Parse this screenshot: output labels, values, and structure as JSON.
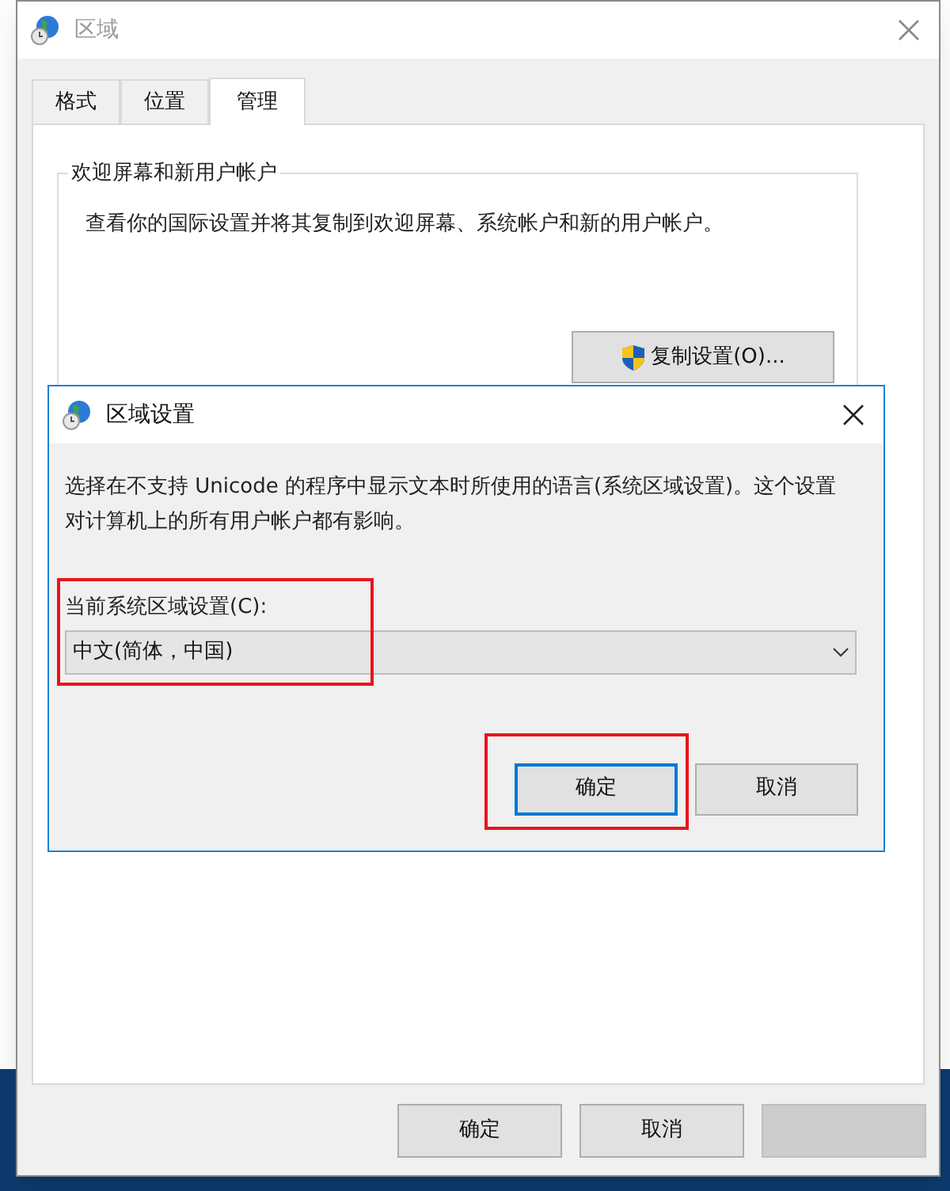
{
  "window": {
    "title": "区域",
    "tabs": [
      {
        "label": "格式",
        "selected": false
      },
      {
        "label": "位置",
        "selected": false
      },
      {
        "label": "管理",
        "selected": true
      }
    ],
    "group": {
      "title": "欢迎屏幕和新用户帐户",
      "text": "查看你的国际设置并将其复制到欢迎屏幕、系统帐户和新的用户帐户。",
      "button": "复制设置(O)..."
    },
    "buttons": [
      {
        "label": "确定",
        "disabled": false
      },
      {
        "label": "取消",
        "disabled": false
      },
      {
        "disabled": true
      }
    ]
  },
  "dialog": {
    "title": "区域设置",
    "description": "选择在不支持 Unicode 的程序中显示文本时所使用的语言(系统区域设置)。这个设置对计算机上的所有用户帐户都有影响。",
    "locale_label": "当前系统区域设置(C):",
    "locale_value": "中文(简体，中国)",
    "locale_highlighted": true,
    "buttons": [
      {
        "label": "确定",
        "focused": true,
        "highlighted": true
      },
      {
        "label": "取消",
        "focused": false,
        "highlighted": false
      }
    ]
  }
}
